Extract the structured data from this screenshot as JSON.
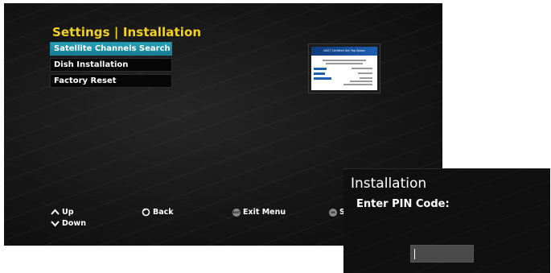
{
  "settings_screen": {
    "title": "Settings | Installation",
    "menu_items": [
      {
        "label": "Satellite Channels Search",
        "selected": true
      },
      {
        "label": "Dish Installation",
        "selected": false
      },
      {
        "label": "Factory Reset",
        "selected": false
      }
    ],
    "preview": {
      "header": "VAST Certified Set Top Boxes"
    },
    "footer": {
      "up_label": "Up",
      "down_label": "Down",
      "back_label": "Back",
      "exit_key": "EXIT",
      "exit_label": "Exit Menu",
      "ok_key": "OK",
      "ok_label": "S"
    }
  },
  "pin_dialog": {
    "title": "Installation",
    "prompt": "Enter PIN Code:",
    "value": ""
  },
  "colors": {
    "title_yellow": "#f2d21e",
    "selected_teal": "#1b8aa0",
    "background": "#161616"
  }
}
